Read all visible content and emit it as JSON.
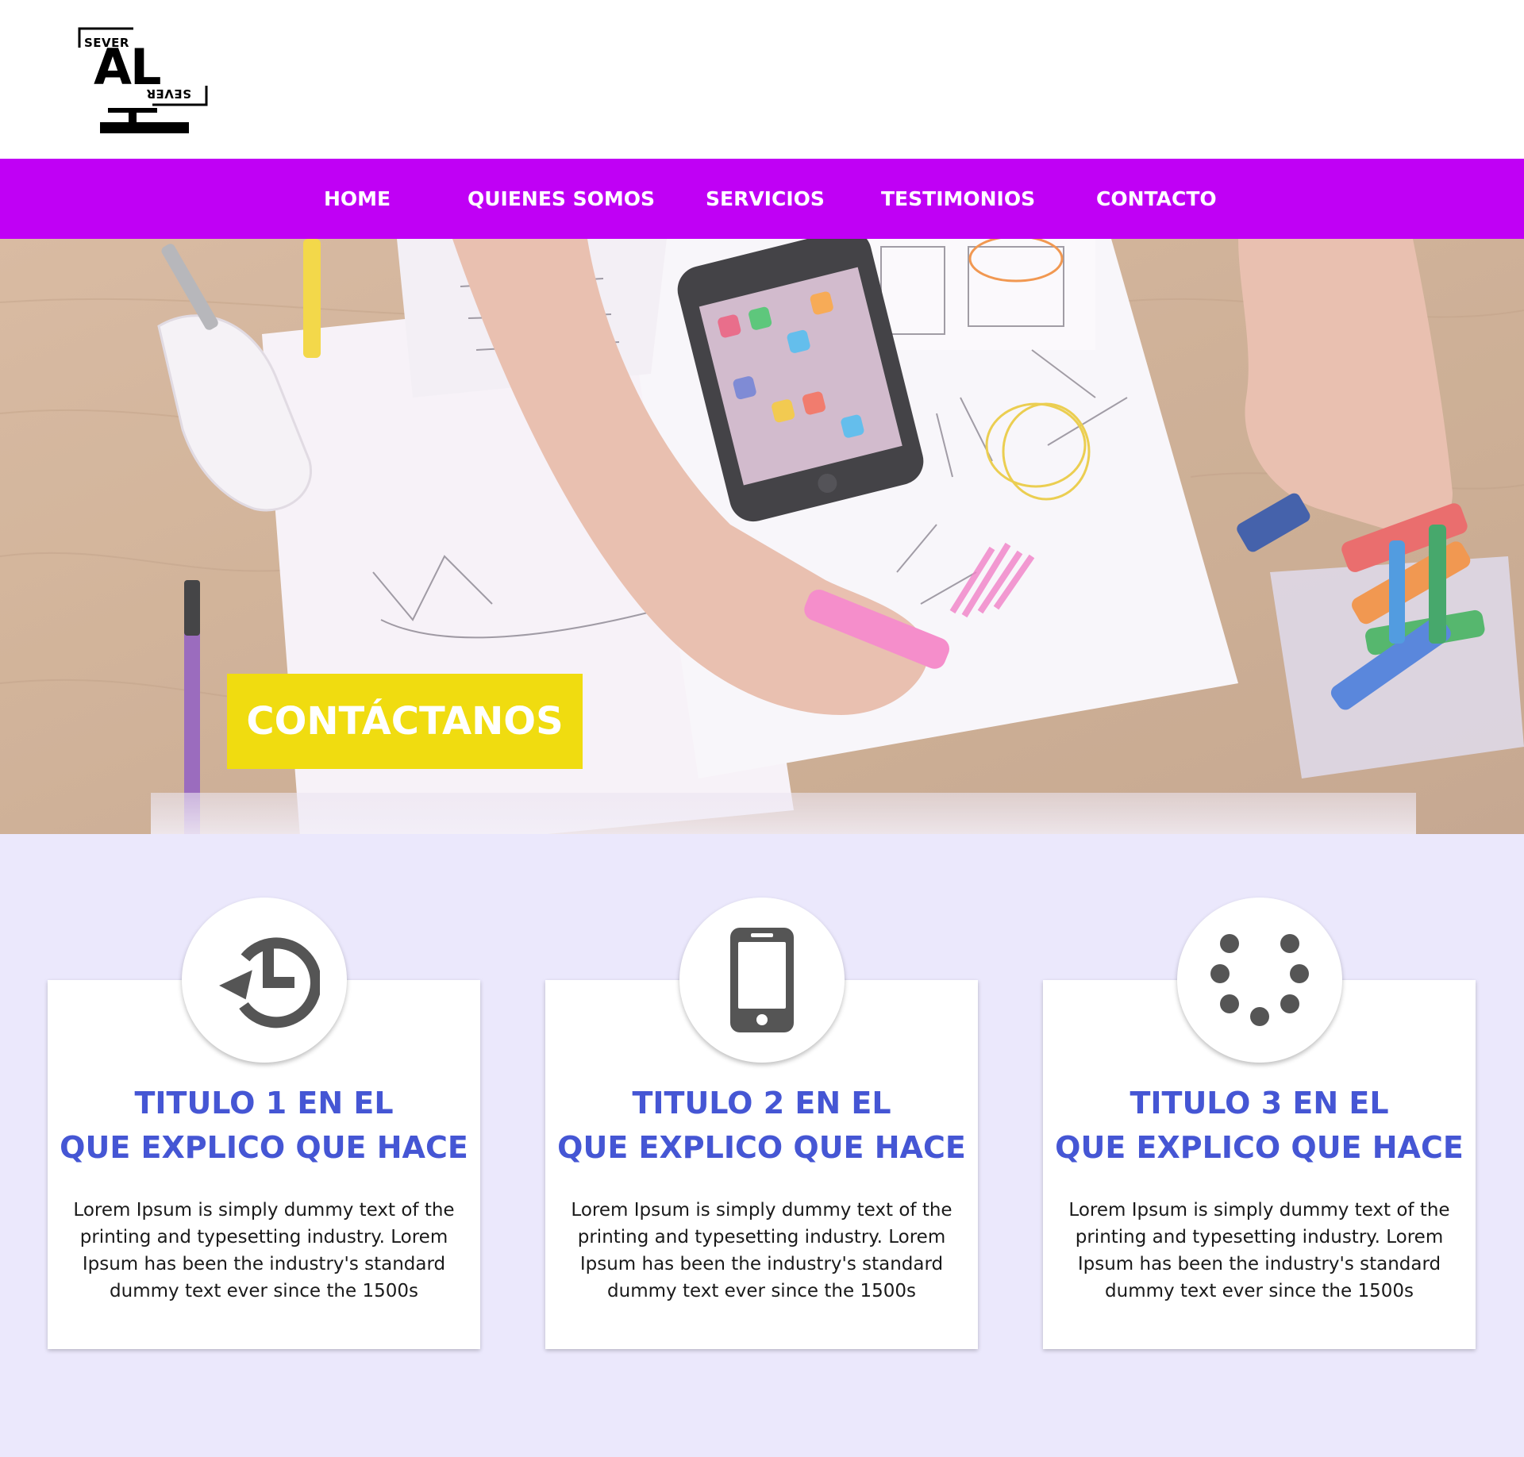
{
  "logo": {
    "word_top": "SEVER",
    "word_main": "AL",
    "word_bottom": "SEVER"
  },
  "nav": {
    "items": [
      {
        "label": "HOME"
      },
      {
        "label": "QUIENES SOMOS"
      },
      {
        "label": "SERVICIOS"
      },
      {
        "label": "TESTIMONIOS"
      },
      {
        "label": "CONTACTO"
      }
    ]
  },
  "hero": {
    "cta_label": "CONTÁCTANOS"
  },
  "features": {
    "cards": [
      {
        "icon": "history-icon",
        "title_line1": "TITULO 1 EN EL",
        "title_line2": "QUE EXPLICO QUE HACE",
        "text": "Lorem Ipsum is simply dummy text of the printing and typesetting industry. Lorem Ipsum has been the industry's standard dummy text ever since the 1500s"
      },
      {
        "icon": "smartphone-icon",
        "title_line1": "TITULO 2 EN EL",
        "title_line2": "QUE EXPLICO QUE HACE",
        "text": "Lorem Ipsum is simply dummy text of the printing and typesetting industry. Lorem Ipsum has been the industry's standard dummy text ever since the 1500s"
      },
      {
        "icon": "loading-dots-icon",
        "title_line1": "TITULO 3 EN EL",
        "title_line2": "QUE EXPLICO QUE HACE",
        "text": "Lorem Ipsum is simply dummy text of the printing and typesetting industry. Lorem Ipsum has been the industry's standard dummy text ever since the 1500s"
      }
    ]
  },
  "colors": {
    "nav_bg": "#c000f5",
    "cta_bg": "#f0dc10",
    "features_bg": "#ebe8fc",
    "title": "#4556d4",
    "icon": "#555555"
  }
}
